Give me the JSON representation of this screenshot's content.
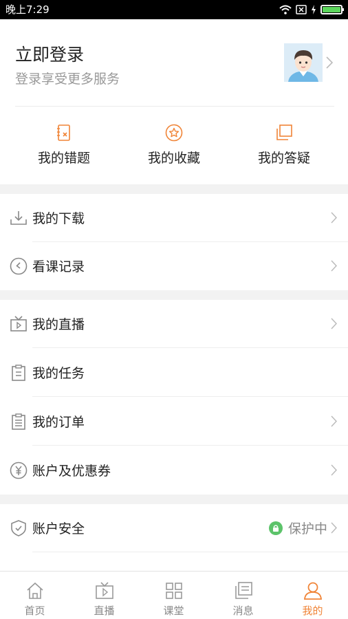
{
  "status_bar": {
    "time": "晚上7:29"
  },
  "profile": {
    "title": "立即登录",
    "subtitle": "登录享受更多服务"
  },
  "quick_actions": [
    {
      "label": "我的错题",
      "icon": "wrong-questions-icon"
    },
    {
      "label": "我的收藏",
      "icon": "favorites-star-icon"
    },
    {
      "label": "我的答疑",
      "icon": "qa-icon"
    }
  ],
  "menu": {
    "downloads": "我的下载",
    "history": "看课记录",
    "live": "我的直播",
    "tasks": "我的任务",
    "orders": "我的订单",
    "coupons": "账户及优惠券",
    "security": "账户安全",
    "security_status": "保护中"
  },
  "tabbar": {
    "items": [
      {
        "label": "首页",
        "icon": "home-icon"
      },
      {
        "label": "直播",
        "icon": "tv-icon"
      },
      {
        "label": "课堂",
        "icon": "grid-icon"
      },
      {
        "label": "消息",
        "icon": "message-icon"
      },
      {
        "label": "我的",
        "icon": "user-icon"
      }
    ],
    "active_index": 4
  },
  "colors": {
    "accent": "#f08437",
    "status_green": "#5cc36a",
    "text_secondary": "#999999"
  }
}
